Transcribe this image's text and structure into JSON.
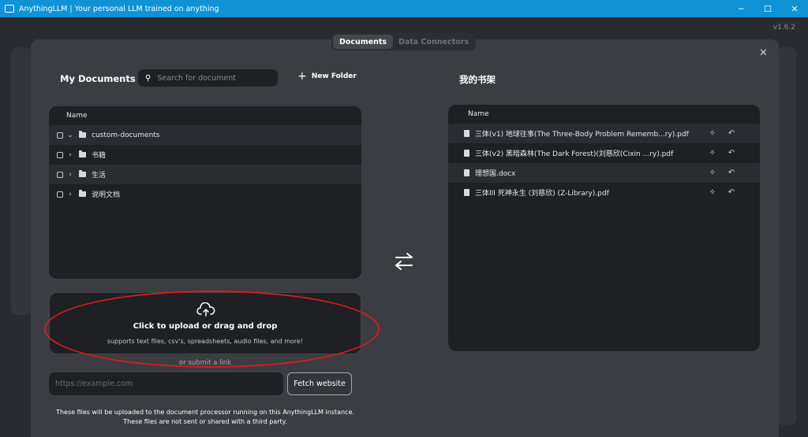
{
  "window": {
    "title": "AnythingLLM | Your personal LLM trained on anything",
    "controls": [
      "─",
      "☐",
      "✕"
    ]
  },
  "version": "v1.6.2",
  "tabs": [
    {
      "label": "Documents",
      "active": true
    },
    {
      "label": "Data Connectors",
      "active": false
    }
  ],
  "my_documents": {
    "title": "My Documents",
    "search_placeholder": "Search for document",
    "new_folder_label": "New Folder",
    "column_name": "Name",
    "folders": [
      {
        "name": "custom-documents",
        "expanded": true
      },
      {
        "name": "书籍",
        "expanded": false
      },
      {
        "name": "生活",
        "expanded": false
      },
      {
        "name": "说明文档",
        "expanded": false
      }
    ]
  },
  "upload": {
    "main_text": "Click to upload or drag and drop",
    "sub_text": "supports text files, csv's, spreadsheets, audio files, and more!",
    "or_link": "or submit a link",
    "url_placeholder": "https://example.com",
    "fetch_label": "Fetch website",
    "footnote_line1": "These files will be uploaded to the document processor running on this AnythingLLM instance.",
    "footnote_line2": "These files are not sent or shared with a third party."
  },
  "workspace": {
    "title": "我的书架",
    "column_name": "Name",
    "files": [
      "三体(v1) 地球往事(The Three-Body Problem Rememb...ry).pdf",
      "三体(v2) 黑暗森林(The Dark Forest)(刘慈欣(Cixin ...ry).pdf",
      "理想国.docx",
      "三体III 死神永生 (刘慈欣) (Z-Library).pdf"
    ]
  },
  "colors": {
    "titlebar": "#0f93d6",
    "annotation": "#d21f1f"
  }
}
